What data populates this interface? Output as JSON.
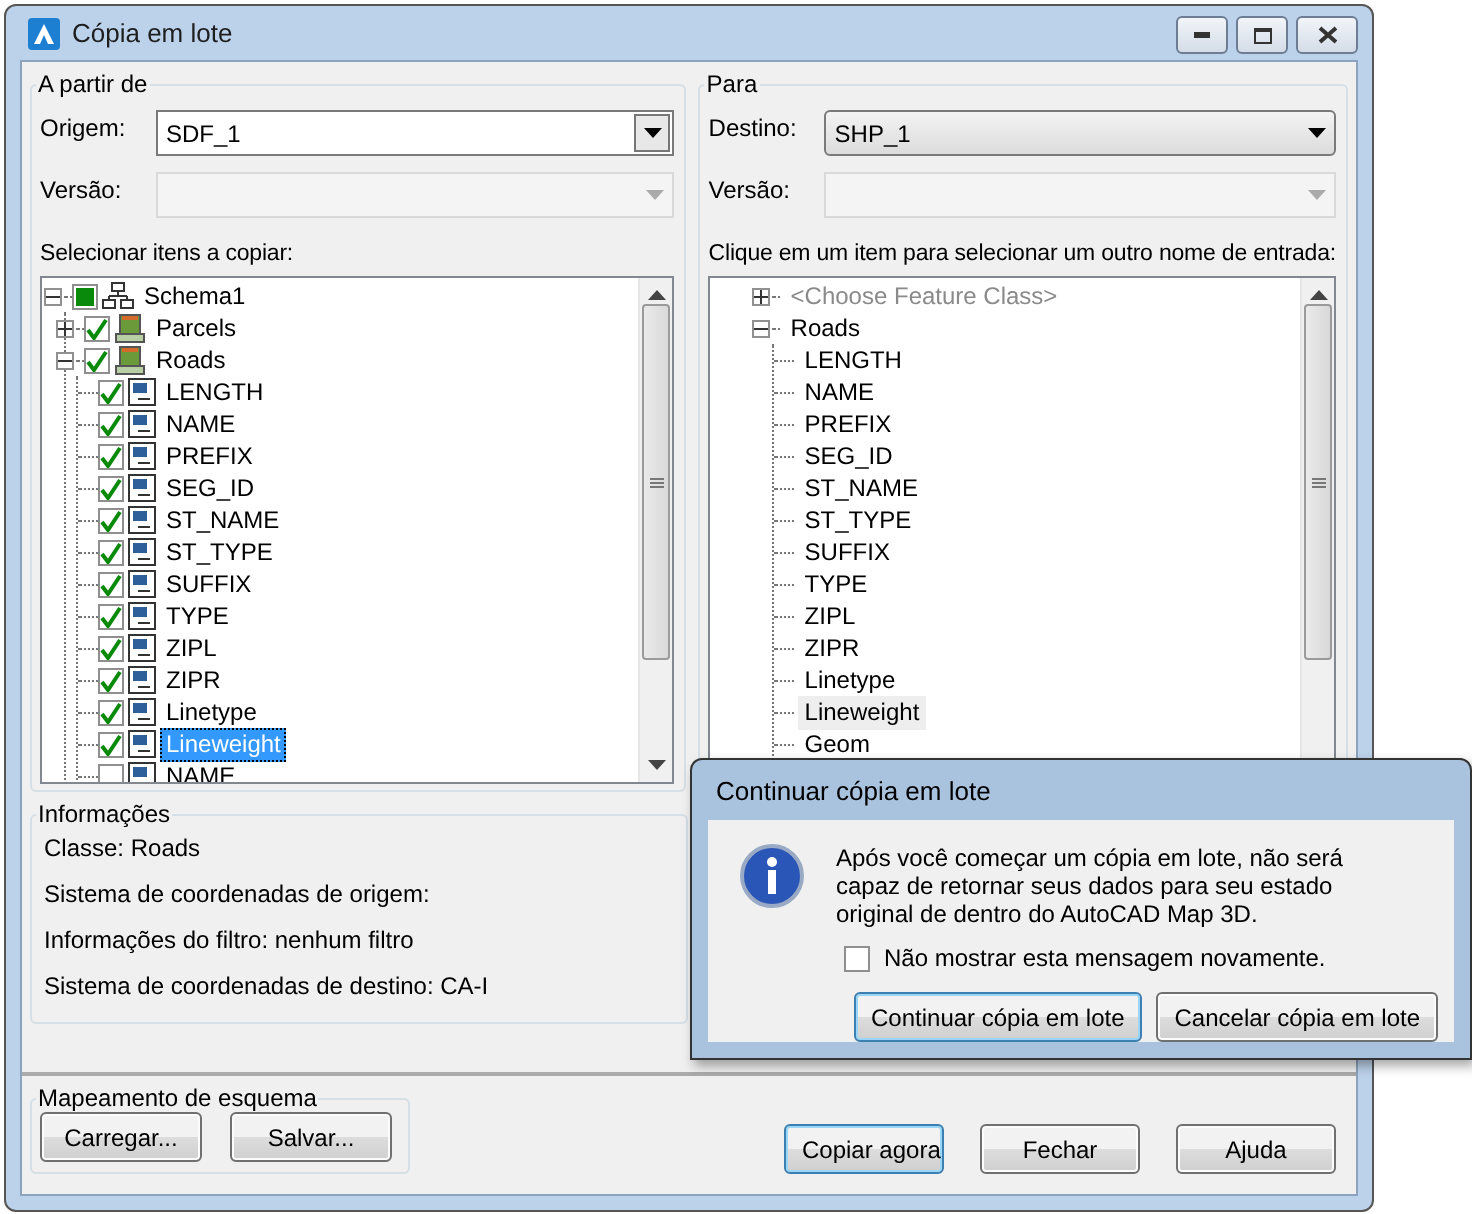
{
  "window": {
    "title": "Cópia em lote"
  },
  "source": {
    "legend": "A partir de",
    "origin_label": "Origem:",
    "origin_value": "SDF_1",
    "version_label": "Versão:",
    "version_disabled": true,
    "tree_label": "Selecionar itens a copiar:",
    "tree": [
      {
        "label": "Schema1",
        "kind": "schema",
        "partial": true,
        "expanded": true,
        "selected": false,
        "children": [
          {
            "label": "Parcels",
            "kind": "table",
            "checked": true,
            "expanded": false,
            "selected": false
          },
          {
            "label": "Roads",
            "kind": "table",
            "checked": true,
            "expanded": true,
            "selected": false,
            "children": [
              {
                "label": "LENGTH",
                "kind": "field",
                "checked": true,
                "selected": false
              },
              {
                "label": "NAME",
                "kind": "field",
                "checked": true,
                "selected": false
              },
              {
                "label": "PREFIX",
                "kind": "field",
                "checked": true,
                "selected": false
              },
              {
                "label": "SEG_ID",
                "kind": "field",
                "checked": true,
                "selected": false
              },
              {
                "label": "ST_NAME",
                "kind": "field",
                "checked": true,
                "selected": false
              },
              {
                "label": "ST_TYPE",
                "kind": "field",
                "checked": true,
                "selected": false
              },
              {
                "label": "SUFFIX",
                "kind": "field",
                "checked": true,
                "selected": false
              },
              {
                "label": "TYPE",
                "kind": "field",
                "checked": true,
                "selected": false
              },
              {
                "label": "ZIPL",
                "kind": "field",
                "checked": true,
                "selected": false
              },
              {
                "label": "ZIPR",
                "kind": "field",
                "checked": true,
                "selected": false
              },
              {
                "label": "Linetype",
                "kind": "field",
                "checked": true,
                "selected": false
              },
              {
                "label": "Lineweight",
                "kind": "field",
                "checked": true,
                "selected": true
              },
              {
                "label": "NAME",
                "kind": "field",
                "checked": false,
                "selected": false
              }
            ]
          }
        ]
      }
    ]
  },
  "target": {
    "legend": "Para",
    "dest_label": "Destino:",
    "dest_value": "SHP_1",
    "version_label": "Versão:",
    "version_disabled": true,
    "tree_label": "Clique em um item para selecionar um outro nome de entrada:",
    "tree": [
      {
        "label": "<Choose Feature Class>",
        "dimmed": true,
        "expanded": false,
        "selected": false
      },
      {
        "label": "Roads",
        "dimmed": false,
        "expanded": true,
        "selected": false,
        "children": [
          {
            "label": "LENGTH",
            "selected": false
          },
          {
            "label": "NAME",
            "selected": false
          },
          {
            "label": "PREFIX",
            "selected": false
          },
          {
            "label": "SEG_ID",
            "selected": false
          },
          {
            "label": "ST_NAME",
            "selected": false
          },
          {
            "label": "ST_TYPE",
            "selected": false
          },
          {
            "label": "SUFFIX",
            "selected": false
          },
          {
            "label": "TYPE",
            "selected": false
          },
          {
            "label": "ZIPL",
            "selected": false
          },
          {
            "label": "ZIPR",
            "selected": false
          },
          {
            "label": "Linetype",
            "selected": false
          },
          {
            "label": "Lineweight",
            "selected": true
          },
          {
            "label": "Geom",
            "selected": false
          }
        ]
      }
    ]
  },
  "info": {
    "legend": "Informações",
    "lines": [
      "Classe: Roads",
      "Sistema de coordenadas de origem:",
      "Informações do filtro: nenhum filtro",
      "Sistema de coordenadas de destino: CA-I"
    ]
  },
  "schema_mapping": {
    "legend": "Mapeamento de esquema",
    "buttons": [
      "Carregar...",
      "Salvar..."
    ]
  },
  "buttons": [
    {
      "label": "Copiar agora",
      "default": true
    },
    {
      "label": "Fechar",
      "default": false
    },
    {
      "label": "Ajuda",
      "default": false
    }
  ],
  "dialog": {
    "title": "Continuar cópia em lote",
    "message": "Após você começar um cópia em lote, não será capaz de retornar seus dados para seu estado original de dentro do AutoCAD Map 3D.",
    "checkbox_label": "Não mostrar esta mensagem novamente.",
    "checkbox_checked": false,
    "buttons": [
      {
        "label": "Continuar cópia em lote",
        "default": true
      },
      {
        "label": "Cancelar cópia em lote",
        "default": false
      }
    ]
  }
}
